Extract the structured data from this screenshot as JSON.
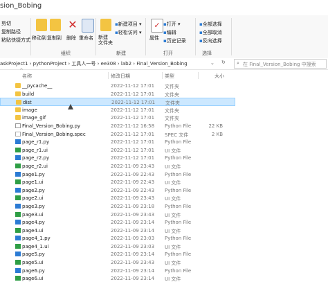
{
  "window": {
    "title": "sion_Bobing"
  },
  "ribbon": {
    "cut": "剪切",
    "copy_path": "复制路径",
    "paste_shortcut": "粘贴快捷方式",
    "move_to": "移动到",
    "copy_to": "复制到",
    "delete": "删除",
    "rename": "重命名",
    "new_folder": "新建\n文件夹",
    "new_item": "新建项目",
    "easy_access": "轻松访问",
    "properties": "属性",
    "open": "打开",
    "edit": "编辑",
    "history": "历史记录",
    "select_all": "全部选择",
    "select_none": "全部取消",
    "invert": "反向选择",
    "group_organize": "组织",
    "group_new": "新建",
    "group_open": "打开",
    "group_select": "选择"
  },
  "address": {
    "crumbs": [
      "askProject1",
      "pythonProject",
      "工具人一号",
      "ee308",
      "lab2",
      "Final_Version_Bobing"
    ],
    "search_placeholder": "在 Final_Version_Bobing 中搜索"
  },
  "columns": {
    "name": "名称",
    "date": "修改日期",
    "type": "类型",
    "size": "大小"
  },
  "files": [
    {
      "name": "__pycache__",
      "date": "2022-11-12 17:01",
      "type": "文件夹",
      "size": "",
      "icon": "folder"
    },
    {
      "name": "build",
      "date": "2022-11-12 17:01",
      "type": "文件夹",
      "size": "",
      "icon": "folder"
    },
    {
      "name": "dist",
      "date": "2022-11-12 17:01",
      "type": "文件夹",
      "size": "",
      "icon": "folder",
      "selected": true
    },
    {
      "name": "image",
      "date": "2022-11-12 17:01",
      "type": "文件夹",
      "size": "",
      "icon": "folder"
    },
    {
      "name": "image_gif",
      "date": "2022-11-12 17:01",
      "type": "文件夹",
      "size": "",
      "icon": "folder"
    },
    {
      "name": "Final_Version_Bobing.py",
      "date": "2022-11-12 16:58",
      "type": "Python File",
      "size": "22 KB",
      "icon": "py"
    },
    {
      "name": "Final_Version_Bobing.spec",
      "date": "2022-11-12 17:01",
      "type": "SPEC 文件",
      "size": "2 KB",
      "icon": "spec"
    },
    {
      "name": "page_r1.py",
      "date": "2022-11-12 17:01",
      "type": "Python File",
      "size": "",
      "icon": "pyb"
    },
    {
      "name": "page_r1.ui",
      "date": "2022-11-12 17:01",
      "type": "UI 文件",
      "size": "",
      "icon": "ui"
    },
    {
      "name": "page_r2.py",
      "date": "2022-11-12 17:01",
      "type": "Python File",
      "size": "",
      "icon": "pyb"
    },
    {
      "name": "page_r2.ui",
      "date": "2022-11-09 23:43",
      "type": "UI 文件",
      "size": "",
      "icon": "ui"
    },
    {
      "name": "page1.py",
      "date": "2022-11-09 22:43",
      "type": "Python File",
      "size": "",
      "icon": "pyb"
    },
    {
      "name": "page1.ui",
      "date": "2022-11-09 22:43",
      "type": "UI 文件",
      "size": "",
      "icon": "ui"
    },
    {
      "name": "page2.py",
      "date": "2022-11-09 22:43",
      "type": "Python File",
      "size": "",
      "icon": "pyb"
    },
    {
      "name": "page2.ui",
      "date": "2022-11-09 23:43",
      "type": "UI 文件",
      "size": "",
      "icon": "ui"
    },
    {
      "name": "page3.py",
      "date": "2022-11-09 23:18",
      "type": "Python File",
      "size": "",
      "icon": "pyb"
    },
    {
      "name": "page3.ui",
      "date": "2022-11-09 23:43",
      "type": "UI 文件",
      "size": "",
      "icon": "ui"
    },
    {
      "name": "page4.py",
      "date": "2022-11-09 23:14",
      "type": "Python File",
      "size": "",
      "icon": "pyb"
    },
    {
      "name": "page4.ui",
      "date": "2022-11-09 23:14",
      "type": "UI 文件",
      "size": "",
      "icon": "ui"
    },
    {
      "name": "page4_1.py",
      "date": "2022-11-09 23:03",
      "type": "Python File",
      "size": "",
      "icon": "pyb"
    },
    {
      "name": "page4_1.ui",
      "date": "2022-11-09 23:03",
      "type": "UI 文件",
      "size": "",
      "icon": "ui"
    },
    {
      "name": "page5.py",
      "date": "2022-11-09 23:14",
      "type": "Python File",
      "size": "",
      "icon": "pyb"
    },
    {
      "name": "page5.ui",
      "date": "2022-11-09 23:43",
      "type": "UI 文件",
      "size": "",
      "icon": "ui"
    },
    {
      "name": "page6.py",
      "date": "2022-11-09 23:14",
      "type": "Python File",
      "size": "",
      "icon": "pyb"
    },
    {
      "name": "page6.ui",
      "date": "2022-11-09 23:14",
      "type": "UI 文件",
      "size": "",
      "icon": "ui"
    }
  ]
}
